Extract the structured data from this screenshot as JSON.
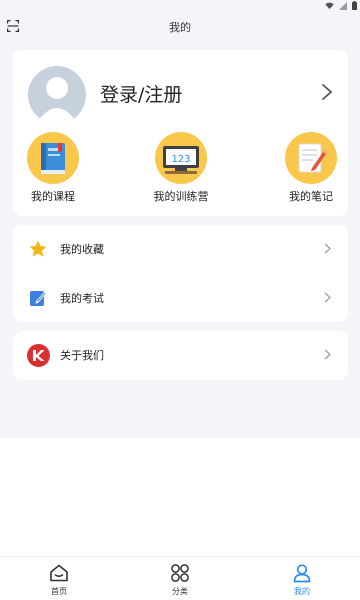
{
  "header": {
    "title": "我的"
  },
  "profile": {
    "login_label": "登录/注册"
  },
  "quick_links": [
    {
      "label": "我的课程",
      "icon": "book-icon"
    },
    {
      "label": "我的训练营",
      "icon": "number-board-icon"
    },
    {
      "label": "我的笔记",
      "icon": "notepad-icon"
    }
  ],
  "menu": {
    "favorites": "我的收藏",
    "exams": "我的考试",
    "about": "关于我们"
  },
  "tabbar": {
    "home": "首页",
    "category": "分类",
    "mine": "我的",
    "active": "mine"
  },
  "board_text": "123",
  "colors": {
    "page_bg": "#f4f5f9",
    "icon_circle": "#f9c74a",
    "accent": "#2f8af5",
    "star": "#f6b518",
    "about_logo": "#d93030"
  }
}
